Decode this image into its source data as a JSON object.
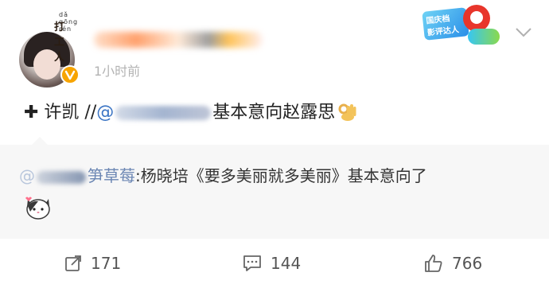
{
  "header": {
    "ribbon_pinyin": "dǎ gōng rén",
    "ribbon_hanzi": "打工人",
    "username": "",
    "time": "1小时前",
    "promo_badge_line1": "国庆档",
    "promo_badge_line2": "影评达人"
  },
  "post": {
    "plus": "✚",
    "text_before": " 许凯 //",
    "mention_prefix": "@",
    "text_after": "基本意向赵露思"
  },
  "repost": {
    "at": "@",
    "name_tail": "笋草莓",
    "text": ":杨晓培《要多美丽就多美丽》基本意向了"
  },
  "actions": {
    "shares": "171",
    "comments": "144",
    "likes": "766"
  },
  "colors": {
    "mention": "#3a74c4",
    "repost_bg": "#f7f7f7",
    "time": "#b3b3b3",
    "verified": "#f7a401"
  }
}
